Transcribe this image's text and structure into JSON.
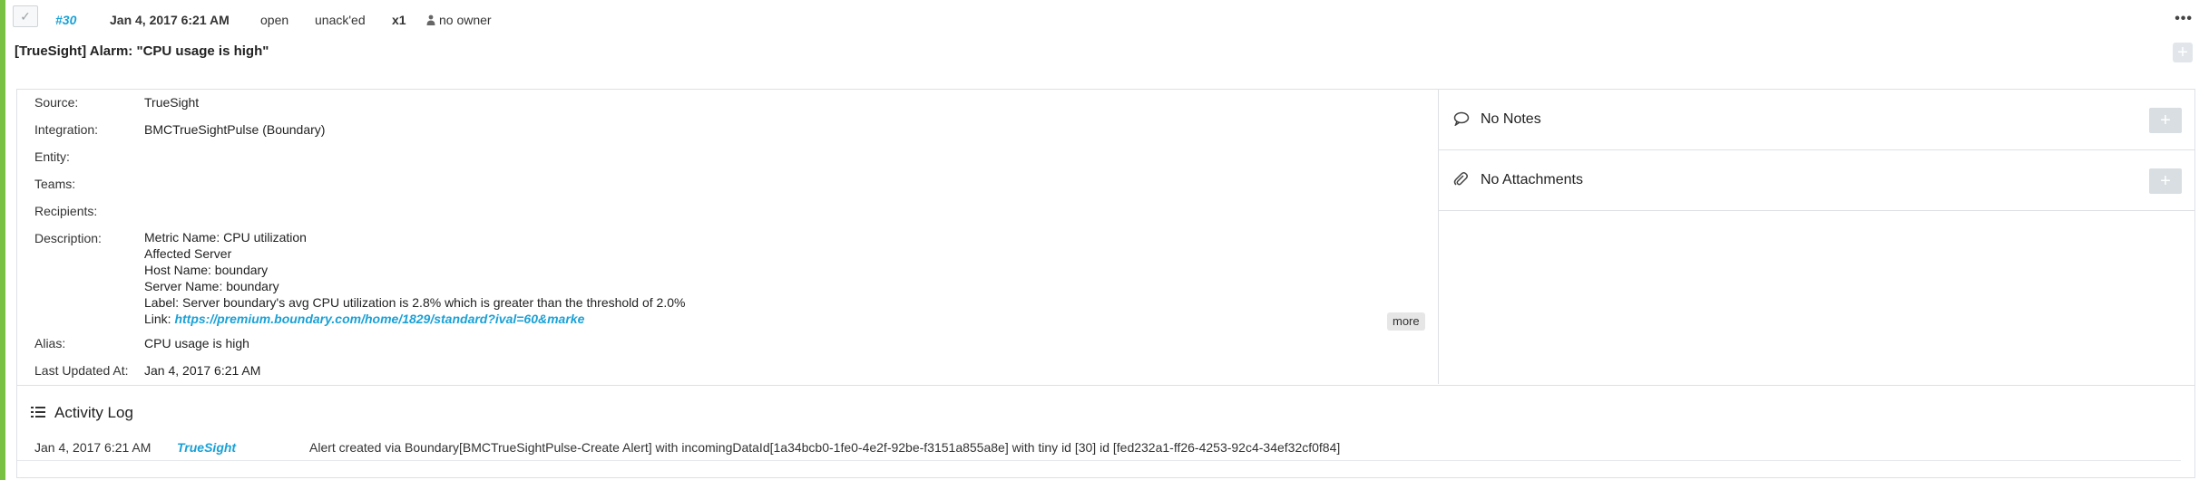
{
  "header": {
    "alert_id": "#30",
    "date": "Jan 4, 2017 6:21 AM",
    "status": "open",
    "ack_status": "unack'ed",
    "count": "x1",
    "owner": "no owner",
    "check_icon": "check-icon",
    "more_icon": "ellipsis-icon"
  },
  "title": "[TrueSight] Alarm: \"CPU usage is high\"",
  "details": {
    "source": {
      "label": "Source:",
      "value": "TrueSight"
    },
    "integration": {
      "label": "Integration:",
      "value": "BMCTrueSightPulse (Boundary)"
    },
    "entity": {
      "label": "Entity:",
      "value": ""
    },
    "teams": {
      "label": "Teams:",
      "value": ""
    },
    "recipients": {
      "label": "Recipients:",
      "value": ""
    },
    "description": {
      "label": "Description:",
      "lines": [
        "Metric Name: CPU utilization",
        "Affected Server",
        "Host Name: boundary",
        "Server Name: boundary",
        "Label: Server boundary's avg CPU utilization is 2.8% which is greater than the threshold of 2.0%"
      ],
      "link_prefix": "Link: ",
      "link_text": "https://premium.boundary.com/home/1829/standard?ival=60&marke",
      "more_label": "more"
    },
    "alias": {
      "label": "Alias:",
      "value": "CPU usage is high"
    },
    "last_updated": {
      "label": "Last Updated At:",
      "value": "Jan 4, 2017 6:21 AM"
    }
  },
  "side": {
    "notes": {
      "label": "No Notes",
      "icon": "speech-bubble-icon"
    },
    "attachments": {
      "label": "No Attachments",
      "icon": "paperclip-icon"
    },
    "add_label": "+"
  },
  "activity": {
    "title": "Activity Log",
    "icon": "list-icon",
    "entries": [
      {
        "date": "Jan 4, 2017 6:21 AM",
        "user": "TrueSight",
        "message": "Alert created via Boundary[BMCTrueSightPulse-Create Alert] with incomingDataId[1a34bcb0-1fe0-4e2f-92be-f3151a855a8e] with tiny id [30] id [fed232a1-ff26-4253-92c4-34ef32cf0f84]"
      }
    ]
  },
  "colors": {
    "accent": "#79c143",
    "link": "#1aa1d6",
    "border": "#dde1e5"
  }
}
